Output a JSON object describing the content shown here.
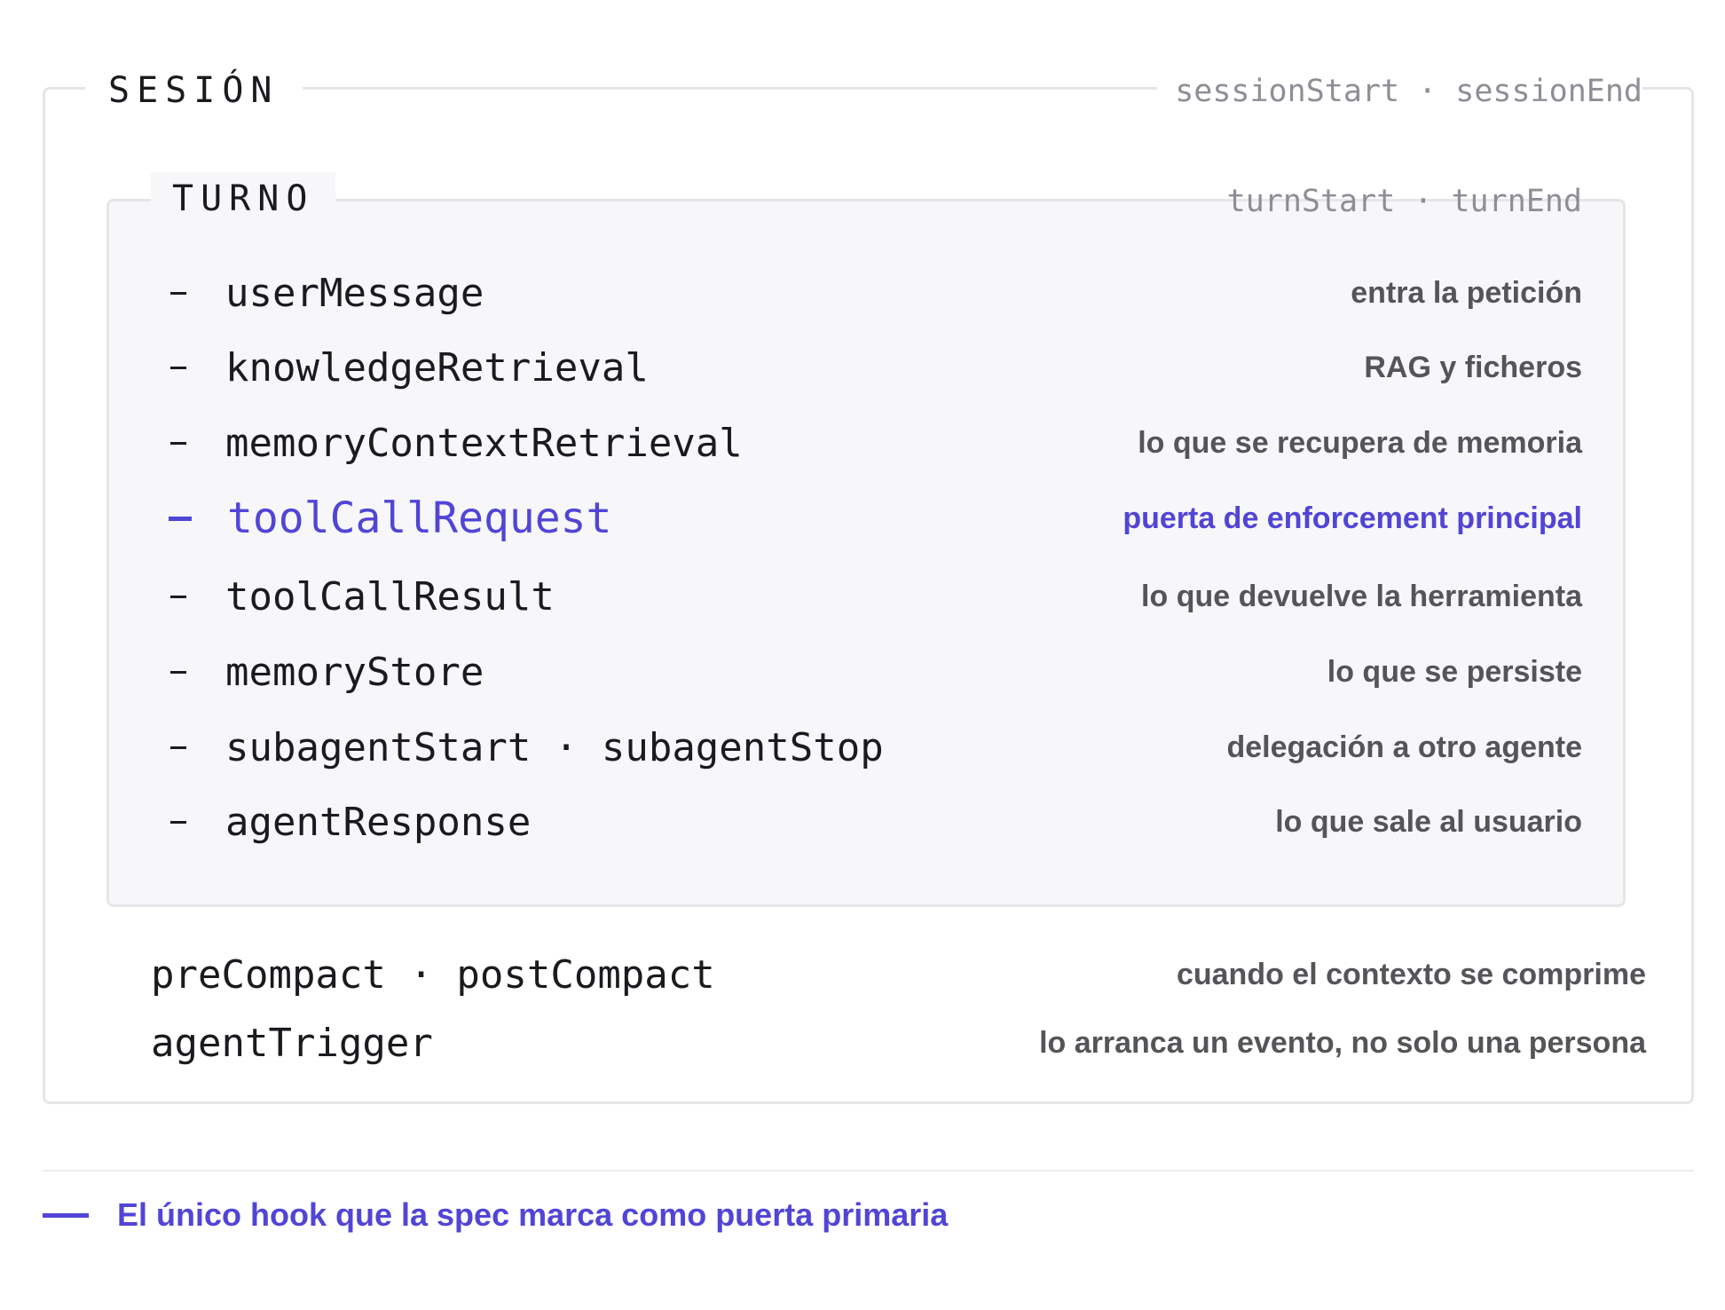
{
  "session": {
    "title": "SESIÓN",
    "events": "sessionStart · sessionEnd",
    "hooks": [
      {
        "name": "preCompact · postCompact",
        "desc": "cuando el contexto se comprime"
      },
      {
        "name": "agentTrigger",
        "desc": "lo arranca un evento, no solo una persona"
      }
    ]
  },
  "turn": {
    "title": "TURNO",
    "events": "turnStart · turnEnd",
    "hooks": [
      {
        "name": "userMessage",
        "desc": "entra la petición"
      },
      {
        "name": "knowledgeRetrieval",
        "desc": "RAG y ficheros"
      },
      {
        "name": "memoryContextRetrieval",
        "desc": "lo que se recupera de memoria"
      },
      {
        "name": "toolCallRequest",
        "desc": "puerta de enforcement principal"
      },
      {
        "name": "toolCallResult",
        "desc": "lo que devuelve la herramienta"
      },
      {
        "name": "memoryStore",
        "desc": "lo que se persiste"
      },
      {
        "name": "subagentStart · subagentStop",
        "desc": "delegación a otro agente"
      },
      {
        "name": "agentResponse",
        "desc": "lo que sale al usuario"
      }
    ]
  },
  "legend": {
    "text": "El único hook que la spec marca como puerta primaria"
  },
  "colors": {
    "accent": "#5145d6",
    "text": "#1a1a1f",
    "muted": "#8e8e96",
    "desc": "#555559",
    "border": "#e6e6ea",
    "turn_bg": "#f7f7f9"
  }
}
